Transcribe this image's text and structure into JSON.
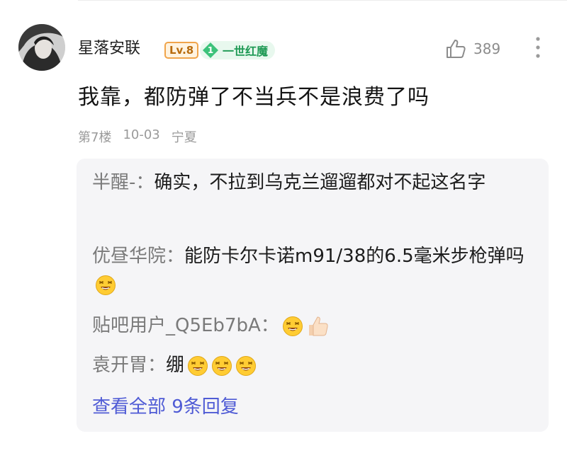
{
  "comment": {
    "username": "星落安联",
    "level_badge": "Lv.8",
    "title_badge_number": "1",
    "title_badge_text": "一世红魔",
    "like_count": "389",
    "text": "我靠，都防弹了不当兵不是浪费了吗",
    "floor": "第7楼",
    "date": "10-03",
    "location": "宁夏"
  },
  "replies": [
    {
      "name": "半醒-：",
      "text": "确实，不拉到乌克兰遛遛都对不起这名字",
      "emojis": []
    },
    {
      "name": "优昼华院：",
      "text": "能防卡尔卡诺m91/38的6.5毫米步枪弹吗",
      "emojis": [
        "laughing-face-icon"
      ]
    },
    {
      "name": "贴吧用户_Q5Eb7bA：",
      "text": "",
      "emojis": [
        "laughing-face-icon",
        "thumbs-up-icon"
      ]
    },
    {
      "name": "袁开胃：",
      "text": "绷",
      "emojis": [
        "laughing-face-icon",
        "laughing-face-icon",
        "laughing-face-icon"
      ]
    }
  ],
  "view_all_label": "查看全部 9条回复",
  "colors": {
    "link": "#4f5bd5",
    "level_border": "#f0a44a",
    "title_badge_green": "#3cc27a",
    "reply_panel_bg": "#f5f5f7"
  }
}
